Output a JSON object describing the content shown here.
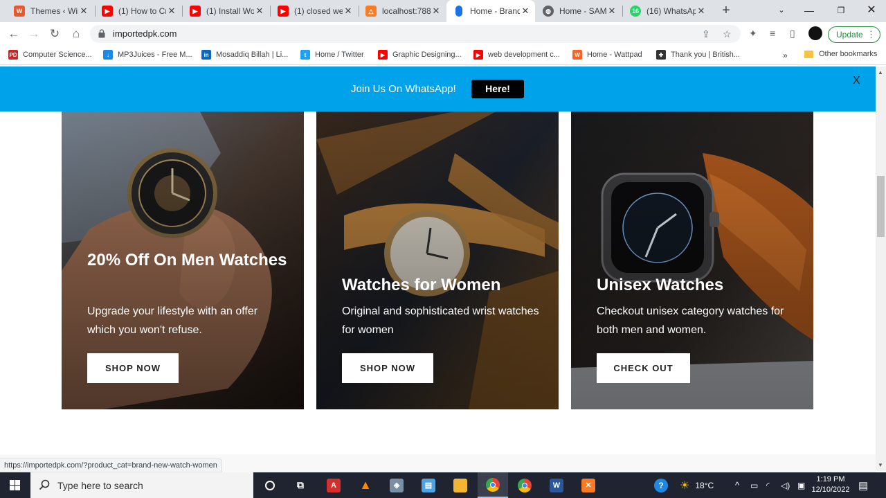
{
  "browser": {
    "tabs": [
      {
        "title": "Themes ‹ Wir",
        "icon": "wordpress-icon",
        "color": "#e8572d"
      },
      {
        "title": "(1) How to Cr",
        "icon": "youtube-icon",
        "color": "#ff0000"
      },
      {
        "title": "(1) Install Wo",
        "icon": "youtube-icon",
        "color": "#ff0000"
      },
      {
        "title": "(1) closed we",
        "icon": "youtube-icon",
        "color": "#ff0000"
      },
      {
        "title": "localhost:788",
        "icon": "xampp-icon",
        "color": "#fb7a24"
      },
      {
        "title": "Home - Brand",
        "icon": "watch-icon",
        "color": "#1a73e8"
      },
      {
        "title": "Home - SAM",
        "icon": "globe-icon",
        "color": "#5f6368"
      },
      {
        "title": "(16) WhatsAp",
        "icon": "whatsapp-icon",
        "color": "#25d366"
      }
    ],
    "active_tab": 5,
    "url": "importedpk.com",
    "update_label": "Update",
    "bookmarks": [
      {
        "label": "Computer Science...",
        "badge": "PD",
        "color": "#c62828"
      },
      {
        "label": "MP3Juices - Free M...",
        "badge": "↓",
        "color": "#1e88e5"
      },
      {
        "label": "Mosaddiq Billah | Li...",
        "badge": "in",
        "color": "#0a66c2"
      },
      {
        "label": "Home / Twitter",
        "badge": "t",
        "color": "#1da1f2"
      },
      {
        "label": "Graphic Designing...",
        "badge": "▶",
        "color": "#ff0000"
      },
      {
        "label": "web development c...",
        "badge": "▶",
        "color": "#ff0000"
      },
      {
        "label": "Home - Wattpad",
        "badge": "W",
        "color": "#ff6122"
      },
      {
        "label": "Thank you | British...",
        "badge": "✚",
        "color": "#333333"
      }
    ],
    "bookmarks_more": "»",
    "other_bookmarks": "Other bookmarks",
    "status_url": "https://importedpk.com/?product_cat=brand-new-watch-women"
  },
  "page": {
    "banner": {
      "text": "Join Us On WhatsApp!",
      "button": "Here!",
      "close": "X",
      "color": "#00a2ea"
    },
    "cards": [
      {
        "heading": "20% Off On Men Watches",
        "subtitle": "Upgrade your lifestyle with an offer which you won't refuse.",
        "button": "SHOP NOW"
      },
      {
        "heading": "Watches for Women",
        "subtitle": "Original and sophisticated wrist watches for women",
        "button": "SHOP NOW"
      },
      {
        "heading": "Unisex Watches",
        "subtitle": "Checkout unisex category watches for both men and women.",
        "button": "CHECK OUT"
      }
    ]
  },
  "taskbar": {
    "search_placeholder": "Type here to search",
    "apps": [
      "task-view-icon",
      "acrobat-icon",
      "vlc-icon",
      "app-icon",
      "notepad-icon",
      "file-explorer-icon",
      "chrome-icon",
      "chrome-icon",
      "word-icon",
      "xampp-icon"
    ],
    "weather": "18°C",
    "time": "1:19 PM",
    "date": "12/10/2022"
  }
}
